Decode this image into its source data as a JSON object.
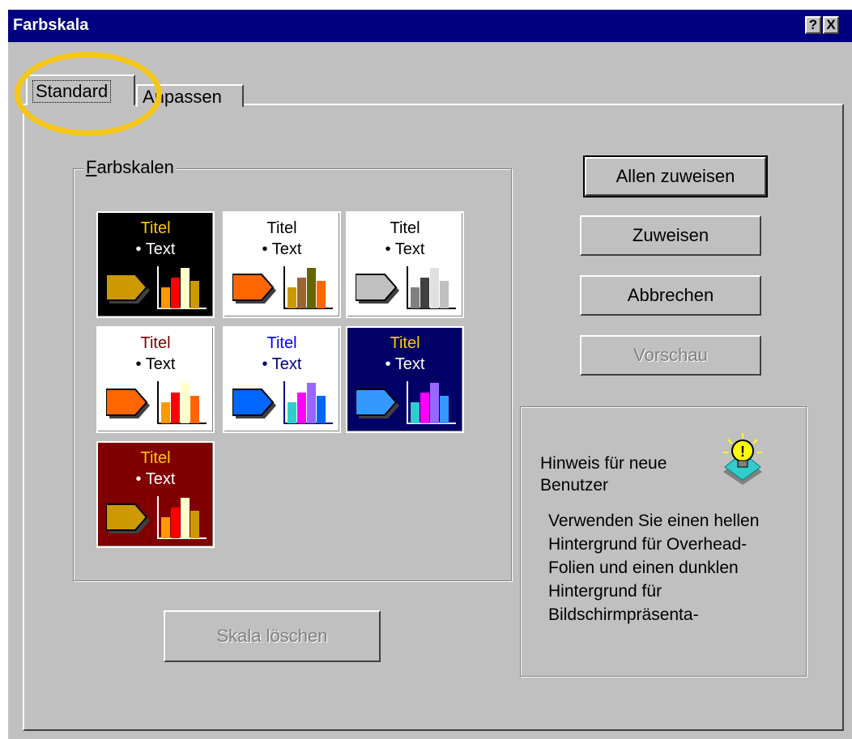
{
  "window": {
    "title": "Farbskala",
    "help_label": "?",
    "close_label": "X"
  },
  "tabs": [
    {
      "label": "Standard",
      "active": true
    },
    {
      "label": "Anpassen",
      "active": false
    }
  ],
  "group": {
    "label": "Farbskalen"
  },
  "schemes": [
    {
      "title": "Titel",
      "text": "• Text",
      "bg": "#000000",
      "title_color": "#ffcc00",
      "text_color": "#ffffff",
      "colors": [
        "#cc9900",
        "#ff9900",
        "#ff0000",
        "#ffffcc"
      ]
    },
    {
      "title": "Titel",
      "text": "• Text",
      "bg": "#ffffff",
      "title_color": "#000000",
      "text_color": "#000000",
      "colors": [
        "#ff6600",
        "#cc9900",
        "#996633",
        "#666600"
      ]
    },
    {
      "title": "Titel",
      "text": "• Text",
      "bg": "#ffffff",
      "title_color": "#000000",
      "text_color": "#000000",
      "colors": [
        "#c0c0c0",
        "#808080",
        "#404040",
        "#e0e0e0"
      ]
    },
    {
      "title": "Titel",
      "text": "• Text",
      "bg": "#ffffff",
      "title_color": "#800000",
      "text_color": "#000000",
      "colors": [
        "#ff6600",
        "#ff9900",
        "#ff0000",
        "#ffffcc"
      ]
    },
    {
      "title": "Titel",
      "text": "• Text",
      "bg": "#ffffff",
      "title_color": "#0000ff",
      "text_color": "#000080",
      "colors": [
        "#0066ff",
        "#33cccc",
        "#ff00ff",
        "#9966ff"
      ]
    },
    {
      "title": "Titel",
      "text": "• Text",
      "bg": "#000066",
      "title_color": "#ffcc00",
      "text_color": "#ffffff",
      "colors": [
        "#3399ff",
        "#33cccc",
        "#ff00ff",
        "#9966ff"
      ]
    },
    {
      "title": "Titel",
      "text": "• Text",
      "bg": "#800000",
      "title_color": "#ffcc00",
      "text_color": "#ffffff",
      "colors": [
        "#cc9900",
        "#ff9900",
        "#ff0000",
        "#ffffcc"
      ]
    }
  ],
  "buttons": {
    "assign_all": "Allen zuweisen",
    "assign": "Zuweisen",
    "cancel": "Abbrechen",
    "preview": "Vorschau",
    "delete_scheme": "Skala löschen"
  },
  "hint": {
    "title": "Hinweis für neue Benutzer",
    "body": "Verwenden Sie einen hellen Hintergrund für Overhead-Folien und einen dunklen Hintergrund für Bildschirmpräsenta-"
  },
  "colors": {
    "titlebar": "#000080",
    "face": "#c0c0c0",
    "highlight_circle": "#f5c518"
  },
  "icons": {
    "bulb": "lightbulb-icon"
  }
}
